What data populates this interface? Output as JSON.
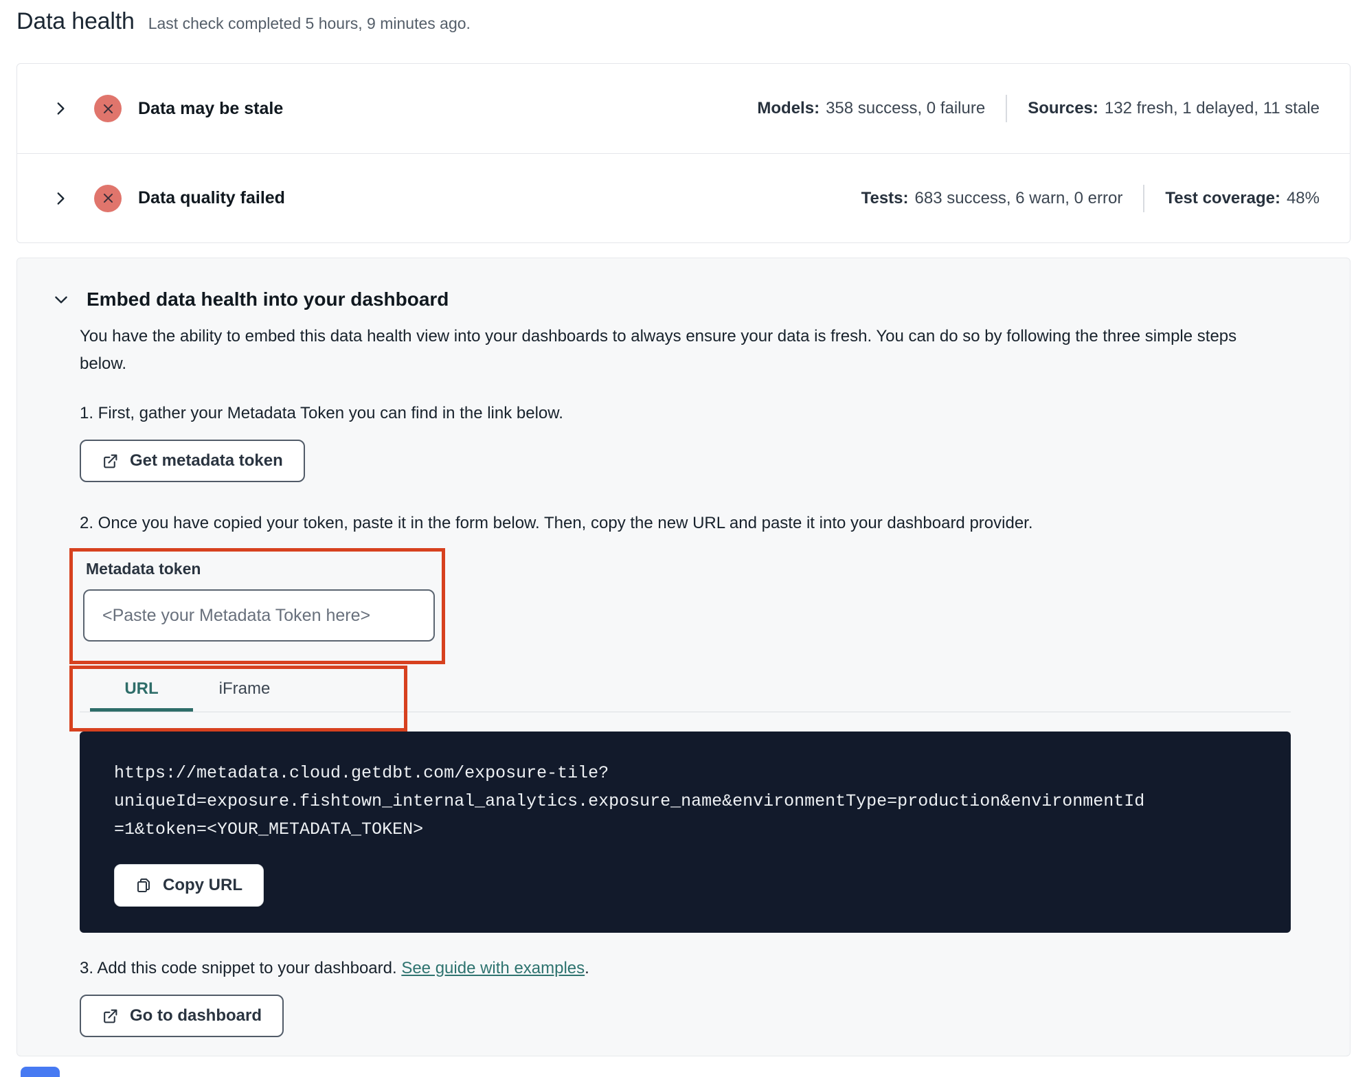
{
  "page": {
    "title": "Data health",
    "subtitle": "Last check completed 5 hours, 9 minutes ago."
  },
  "status_rows": [
    {
      "title": "Data may be stale",
      "status_icon": "x-circle-icon",
      "stats": [
        {
          "label": "Models:",
          "value": "358 success, 0 failure"
        },
        {
          "label": "Sources:",
          "value": "132 fresh, 1 delayed, 11 stale"
        }
      ]
    },
    {
      "title": "Data quality failed",
      "status_icon": "x-circle-icon",
      "stats": [
        {
          "label": "Tests:",
          "value": "683 success, 6 warn, 0 error"
        },
        {
          "label": "Test coverage:",
          "value": "48%"
        }
      ]
    }
  ],
  "embed": {
    "title": "Embed data health into your dashboard",
    "description": "You have the ability to embed this data health view into your dashboards to always ensure your data is fresh. You can do so by following the three simple steps below.",
    "step1": "1. First, gather your Metadata Token you can find in the link below.",
    "get_token_button": "Get metadata token",
    "step2": "2. Once you have copied your token, paste it in the form below. Then, copy the new URL and paste it into your dashboard provider.",
    "token_field": {
      "label": "Metadata token",
      "value": "",
      "placeholder": "<Paste your Metadata Token here>"
    },
    "tabs": [
      {
        "label": "URL",
        "active": true
      },
      {
        "label": "iFrame",
        "active": false
      }
    ],
    "code_lines": [
      "https://metadata.cloud.getdbt.com/exposure-tile?",
      "uniqueId=exposure.fishtown_internal_analytics.exposure_name&environmentType=production&environmentId",
      "=1&token=<YOUR_METADATA_TOKEN>"
    ],
    "copy_url_button": "Copy URL",
    "step3_prefix": "3. Add this code snippet to your dashboard. ",
    "step3_link": "See guide with examples",
    "step3_suffix": ".",
    "go_to_dashboard_button": "Go to dashboard"
  },
  "icons": {
    "row_expander": "chevron-right-icon",
    "embed_expander": "chevron-down-icon",
    "status": "x-circle-icon",
    "external_link": "external-link-icon",
    "copy": "copy-icon"
  },
  "colors": {
    "annotation_red": "#d7411f",
    "error_badge_red": "#e0756c",
    "accent_teal": "#2e6d69",
    "code_background": "#121a2b",
    "section_background": "#f7f8f9",
    "bottom_widget_blue": "#477af2"
  }
}
